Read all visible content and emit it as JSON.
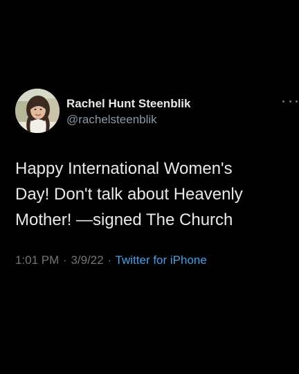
{
  "tweet": {
    "author": {
      "display_name": "Rachel Hunt Steenblik",
      "handle": "@rachelsteenblik",
      "avatar_icon": "profile-photo"
    },
    "text_lines": [
      "Happy International Women's",
      "Day! Don't talk about Heavenly",
      "Mother! —signed The Church"
    ],
    "time": "1:01 PM",
    "separator": "·",
    "date": "3/9/22",
    "source": "Twitter for iPhone",
    "more_icon": "more-dots-icon"
  },
  "colors": {
    "background": "#000000",
    "primary_text": "#e7e9ea",
    "secondary_text": "#71767b",
    "link": "#4a9fe8"
  }
}
